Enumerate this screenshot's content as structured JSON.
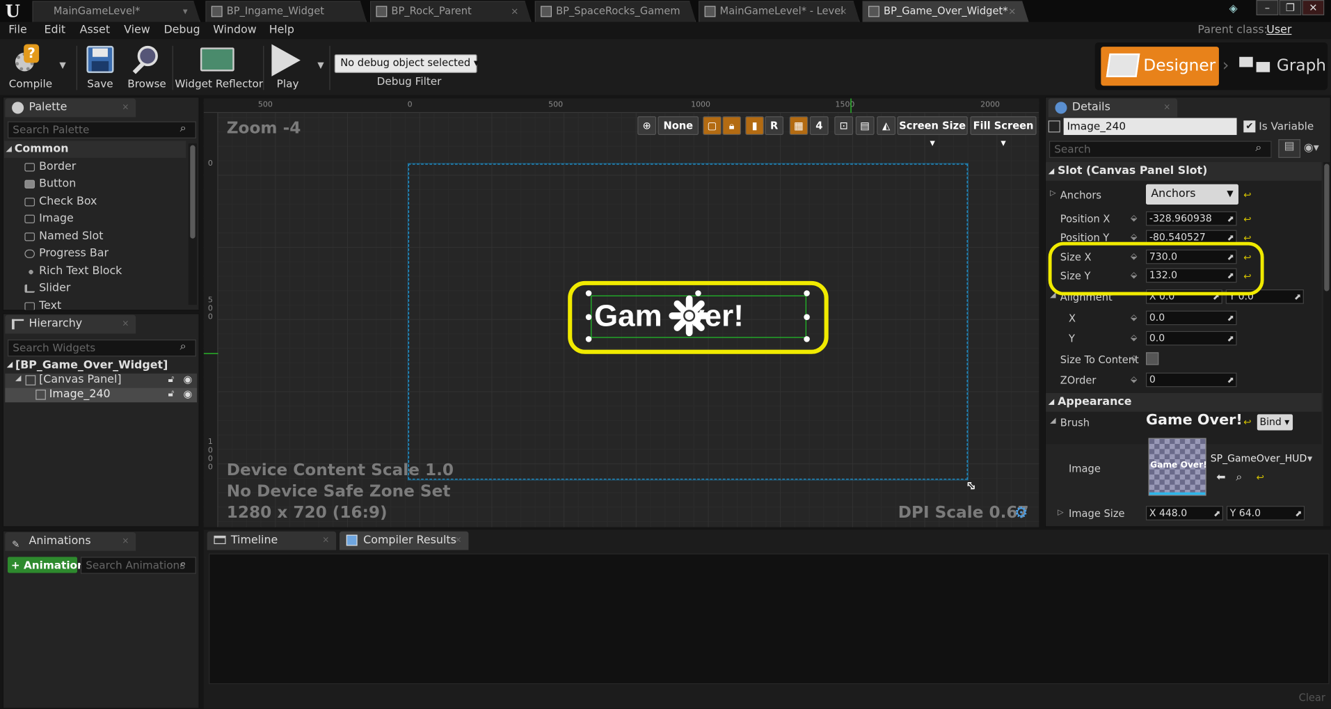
{
  "tabs": [
    {
      "label": "MainGameLevel*"
    },
    {
      "label": "BP_Ingame_Widget"
    },
    {
      "label": "BP_Rock_Parent"
    },
    {
      "label": "BP_SpaceRocks_Gamem"
    },
    {
      "label": "MainGameLevel* - Level"
    },
    {
      "label": "BP_Game_Over_Widget*"
    }
  ],
  "menu": [
    "File",
    "Edit",
    "Asset",
    "View",
    "Debug",
    "Window",
    "Help"
  ],
  "parent_class": {
    "label": "Parent class:",
    "value": "User Widget"
  },
  "toolbar": {
    "compile": "Compile",
    "save": "Save",
    "browse": "Browse",
    "widget_reflector": "Widget Reflector",
    "play": "Play",
    "debug_object": "No debug object selected",
    "debug_filter": "Debug Filter"
  },
  "modes": {
    "designer": "Designer",
    "graph": "Graph"
  },
  "palette": {
    "tab": "Palette",
    "search_placeholder": "Search Palette",
    "category": "Common",
    "items": [
      "Border",
      "Button",
      "Check Box",
      "Image",
      "Named Slot",
      "Progress Bar",
      "Rich Text Block",
      "Slider",
      "Text"
    ]
  },
  "hierarchy": {
    "tab": "Hierarchy",
    "search_placeholder": "Search Widgets",
    "root": "[BP_Game_Over_Widget]",
    "canvas": "[Canvas Panel]",
    "image": "Image_240"
  },
  "animations": {
    "tab": "Animations",
    "add_label": "Animation",
    "search_placeholder": "Search Animations"
  },
  "viewport": {
    "zoom": "Zoom -4",
    "ruler_top": [
      "500",
      "0",
      "500",
      "1000",
      "1500",
      "2000"
    ],
    "ruler_left": [
      "0",
      "5 0 0",
      "1 0 0 0"
    ],
    "toolbar": {
      "none": "None",
      "r": "R",
      "grid": "4",
      "screen_size": "Screen Size",
      "fill_screen": "Fill Screen"
    },
    "device_scale": "Device Content Scale 1.0",
    "safe_zone": "No Device Safe Zone Set",
    "resolution": "1280 x 720 (16:9)",
    "dpi": "DPI Scale 0.67",
    "game_over_text": "Gam   ver!"
  },
  "bottom": {
    "timeline": "Timeline",
    "compiler": "Compiler Results",
    "clear": "Clear"
  },
  "details": {
    "tab": "Details",
    "name": "Image_240",
    "is_variable": "Is Variable",
    "search_placeholder": "Search",
    "slot_header": "Slot (Canvas Panel Slot)",
    "anchors_label": "Anchors",
    "anchors_value": "Anchors",
    "pos_x_label": "Position X",
    "pos_x": "-328.960938",
    "pos_y_label": "Position Y",
    "pos_y": "-80.540527",
    "size_x_label": "Size X",
    "size_x": "730.0",
    "size_y_label": "Size Y",
    "size_y": "132.0",
    "alignment_label": "Alignment",
    "align_x_val": "X 0.0",
    "align_y_val": "Y 0.0",
    "x_label": "X",
    "x_val": "0.0",
    "y_label": "Y",
    "y_val": "0.0",
    "size_to_content": "Size To Content",
    "zorder_label": "ZOrder",
    "zorder": "0",
    "appearance_header": "Appearance",
    "brush_label": "Brush",
    "brush_title": "Game Over!",
    "bind": "Bind",
    "image_label": "Image",
    "image_asset": "SP_GameOver_HUD",
    "thumb_text": "Game Over!",
    "image_size_label": "Image Size",
    "image_size_x": "X 448.0",
    "image_size_y": "Y 64.0"
  },
  "colors": {
    "highlight": "#f0ea00",
    "selection_green": "#22c32a",
    "designer_orange": "#e8821a",
    "canvas_border": "#1e9cdc"
  }
}
